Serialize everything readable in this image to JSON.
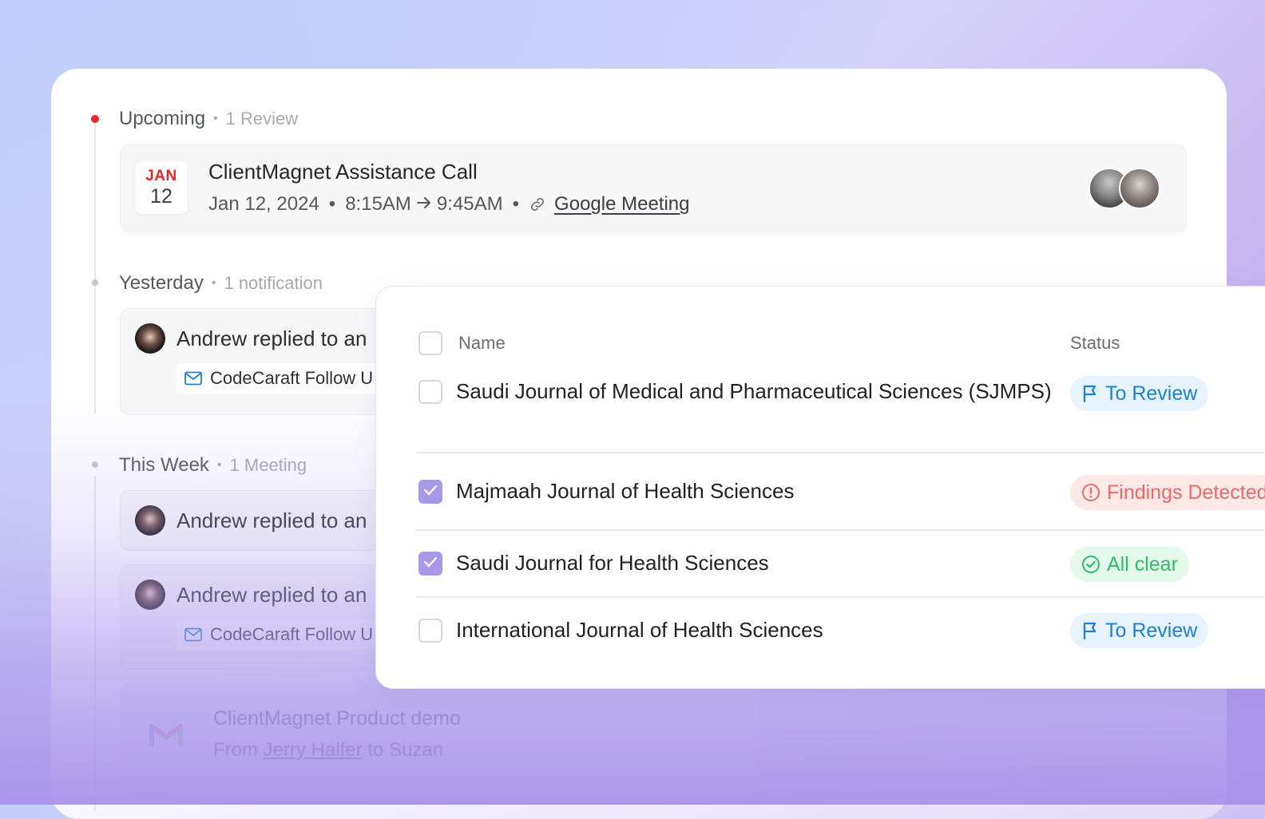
{
  "sections": {
    "upcoming": {
      "title": "Upcoming",
      "meta": "1 Review"
    },
    "yesterday": {
      "title": "Yesterday",
      "meta": "1 notification"
    },
    "this_week": {
      "title": "This Week",
      "meta": "1 Meeting"
    }
  },
  "event": {
    "month": "JAN",
    "day": "12",
    "title": "ClientMagnet Assistance Call",
    "date": "Jan 12, 2024",
    "start": "8:15AM",
    "end": "9:45AM",
    "link_label": "Google Meeting"
  },
  "notifications": [
    {
      "text": "Andrew replied to an",
      "email": "CodeCaraft Follow U"
    },
    {
      "text": "Andrew replied to an"
    },
    {
      "text": "Andrew replied to an",
      "email": "CodeCaraft Follow U"
    }
  ],
  "gmail": {
    "title": "ClientMagnet Product demo",
    "from_prefix": "From",
    "from_name": "Jerry Halfer",
    "from_suffix": "to Suzan"
  },
  "table": {
    "headers": {
      "name": "Name",
      "status": "Status"
    },
    "rows": [
      {
        "name": "Saudi Journal of Medical and Pharmaceutical Sciences (SJMPS)",
        "checked": false,
        "status": "To Review"
      },
      {
        "name": "Majmaah Journal of Health Sciences",
        "checked": true,
        "status": "Findings Detected"
      },
      {
        "name": "Saudi Journal for Health Sciences",
        "checked": true,
        "status": "All clear"
      },
      {
        "name": "International Journal of Health Sciences",
        "checked": false,
        "status": "To Review"
      }
    ]
  },
  "colors": {
    "upcoming_dot": "#e8262b",
    "checkbox_checked": "#a998ea",
    "to_review": "#1f7fd6",
    "findings": "#ea6a6a",
    "all_clear": "#2fbd6a"
  },
  "icons": [
    "link-icon",
    "mail-icon",
    "gmail-icon",
    "flag-icon",
    "alert-circle-icon",
    "check-circle-icon",
    "check-icon"
  ]
}
